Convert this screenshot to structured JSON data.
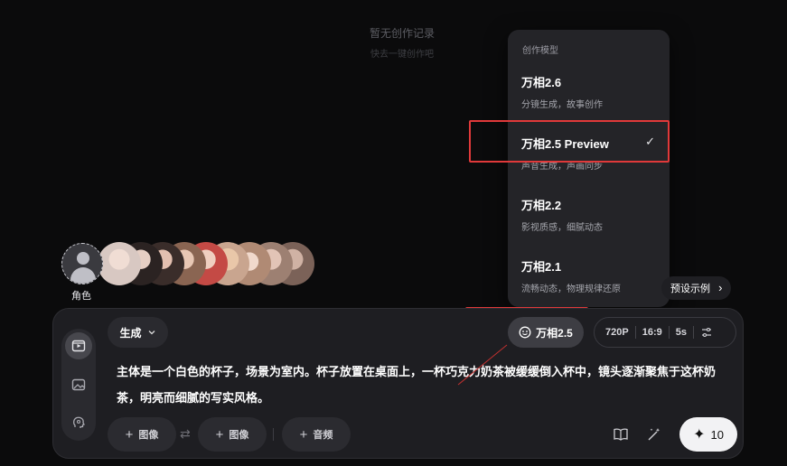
{
  "empty_state": {
    "title": "暂无创作记录",
    "subtitle": "快去一键创作吧"
  },
  "model_dropdown": {
    "header": "创作模型",
    "items": [
      {
        "name": "万相2.6",
        "desc": "分镜生成，故事创作",
        "selected": false
      },
      {
        "name": "万相2.5 Preview",
        "desc": "声音生成，声画同步",
        "selected": true
      },
      {
        "name": "万相2.2",
        "desc": "影视质感，细腻动态",
        "selected": false
      },
      {
        "name": "万相2.1",
        "desc": "流畅动态，物理规律还原",
        "selected": false
      }
    ],
    "check_icon": "✓"
  },
  "characters": {
    "add_label": "角色",
    "avatar_colors": [
      "#d8c8c2",
      "#8f7a70",
      "#b59488",
      "#c47a73",
      "#c9a58f",
      "#d6b3a6",
      "#b08a74",
      "#9d8072"
    ]
  },
  "preset": {
    "label": "预设示例",
    "chevron": "›"
  },
  "toolbar": {
    "mode_label": "生成",
    "mode_chevron": "⌄",
    "model_label": "万相2.5",
    "params": [
      "720P",
      "16:9",
      "5s"
    ]
  },
  "prompt_text": "主体是一个白色的杯子，场景为室内。杯子放置在桌面上，一杯巧克力奶茶被缓缓倒入杯中，镜头逐渐聚焦于这杯奶茶，明亮而细腻的写实风格。",
  "attachments": {
    "image1_label": "图像",
    "image2_label": "图像",
    "audio_label": "音频",
    "plus": "+",
    "swap": "⇄"
  },
  "submit": {
    "icon": "✦",
    "count": "10"
  },
  "colors": {
    "highlight": "#e0393a",
    "panel": "#1e1e22",
    "dropdown": "#242428"
  }
}
